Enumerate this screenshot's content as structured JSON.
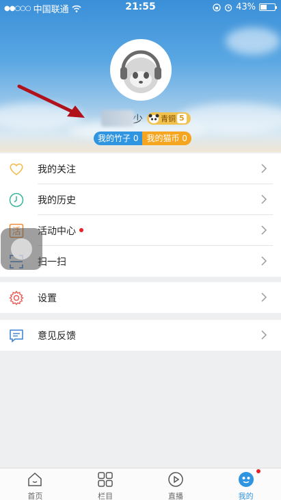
{
  "status_bar": {
    "carrier": "中国联通",
    "time": "21:55",
    "battery": "43%"
  },
  "profile": {
    "name_visible_suffix": "少",
    "level_label": "青铜",
    "level_number": "5",
    "bamboo_label": "我的竹子 0",
    "coin_label": "我的猫币 0"
  },
  "menu_group1": [
    {
      "label": "我的关注",
      "icon": "heart-icon"
    },
    {
      "label": "我的历史",
      "icon": "clock-icon"
    },
    {
      "label": "活动中心",
      "icon": "activity-icon"
    },
    {
      "label": "扫一扫",
      "icon": "scan-icon"
    }
  ],
  "menu_group2": [
    {
      "label": "设置",
      "icon": "gear-icon"
    }
  ],
  "menu_group3": [
    {
      "label": "意见反馈",
      "icon": "feedback-icon"
    }
  ],
  "tabs": [
    {
      "label": "首页",
      "icon": "home-icon"
    },
    {
      "label": "栏目",
      "icon": "grid-icon"
    },
    {
      "label": "直播",
      "icon": "play-icon"
    },
    {
      "label": "我的",
      "icon": "profile-icon"
    }
  ],
  "colors": {
    "accent_blue": "#2f95e0",
    "accent_orange": "#f5a51f",
    "notification_red": "#e8212b"
  }
}
